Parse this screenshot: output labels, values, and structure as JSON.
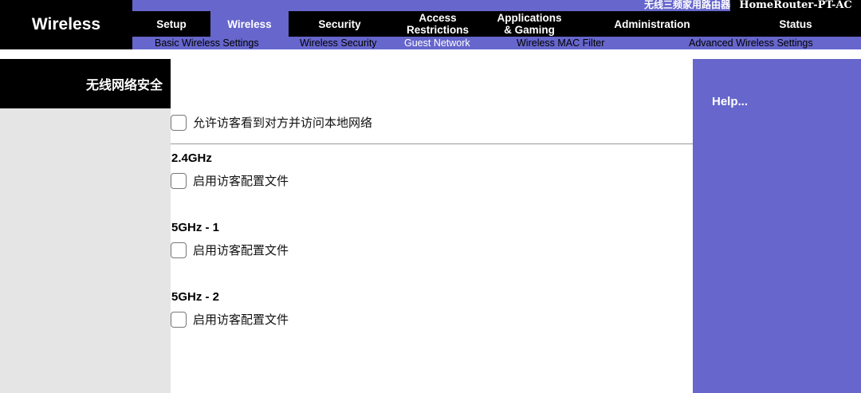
{
  "header": {
    "section_title": "Wireless",
    "product_desc": "无线三频家用路由器",
    "model_name": "HomeRouter-PT-AC",
    "main_tabs": [
      {
        "label": "Setup",
        "active": false
      },
      {
        "label": "Wireless",
        "active": true
      },
      {
        "label": "Security",
        "active": false
      },
      {
        "label": "Access\nRestrictions",
        "active": false
      },
      {
        "label": "Applications\n& Gaming",
        "active": false
      },
      {
        "label": "Administration",
        "active": false
      },
      {
        "label": "Status",
        "active": false
      }
    ],
    "sub_tabs": [
      {
        "label": "Basic Wireless Settings",
        "active": false
      },
      {
        "label": "Wireless Security",
        "active": false
      },
      {
        "label": "Guest Network",
        "active": true
      },
      {
        "label": "Wireless MAC Filter",
        "active": false
      },
      {
        "label": "Advanced Wireless Settings",
        "active": false
      }
    ]
  },
  "page": {
    "heading": "无线网络安全",
    "allow_guest_local_label": "允许访客看到对方并访问本地网络",
    "bands": [
      {
        "title": "2.4GHz",
        "enable_label": "启用访客配置文件"
      },
      {
        "title": "5GHz - 1",
        "enable_label": "启用访客配置文件"
      },
      {
        "title": "5GHz - 2",
        "enable_label": "启用访客配置文件"
      }
    ]
  },
  "help": {
    "label": "Help..."
  },
  "colors": {
    "accent": "#6666cc",
    "header_bg": "#000000",
    "left_panel_bg": "#e5e5e5"
  }
}
